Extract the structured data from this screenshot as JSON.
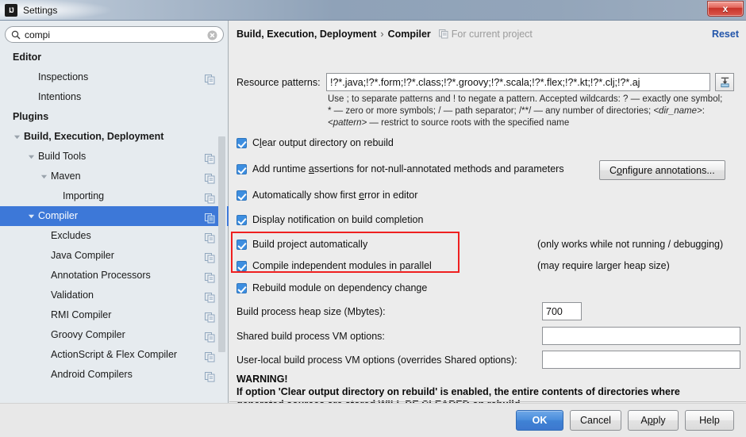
{
  "window": {
    "title": "Settings",
    "app_icon": "intellij-idea-icon",
    "close_label": "x"
  },
  "search": {
    "value": "compi",
    "placeholder": "",
    "icon": "search-icon",
    "clear_icon": "clear-icon"
  },
  "sidebar": {
    "items": [
      {
        "label": "Editor",
        "indent": 16,
        "bold": true,
        "twisty": "",
        "copy": false,
        "selected": false
      },
      {
        "label": "Inspections",
        "indent": 48,
        "bold": false,
        "twisty": "",
        "copy": true,
        "selected": false
      },
      {
        "label": "Intentions",
        "indent": 48,
        "bold": false,
        "twisty": "",
        "copy": false,
        "selected": false
      },
      {
        "label": "Plugins",
        "indent": 16,
        "bold": true,
        "twisty": "",
        "copy": false,
        "selected": false
      },
      {
        "label": "Build, Execution, Deployment",
        "indent": 30,
        "bold": true,
        "twisty": "down",
        "copy": false,
        "selected": false
      },
      {
        "label": "Build Tools",
        "indent": 48,
        "bold": false,
        "twisty": "down",
        "copy": true,
        "selected": false
      },
      {
        "label": "Maven",
        "indent": 64,
        "bold": false,
        "twisty": "down",
        "copy": true,
        "selected": false
      },
      {
        "label": "Importing",
        "indent": 79,
        "bold": false,
        "twisty": "",
        "copy": true,
        "selected": false
      },
      {
        "label": "Compiler",
        "indent": 48,
        "bold": false,
        "twisty": "down",
        "copy": true,
        "selected": true
      },
      {
        "label": "Excludes",
        "indent": 64,
        "bold": false,
        "twisty": "",
        "copy": true,
        "selected": false
      },
      {
        "label": "Java Compiler",
        "indent": 64,
        "bold": false,
        "twisty": "",
        "copy": true,
        "selected": false
      },
      {
        "label": "Annotation Processors",
        "indent": 64,
        "bold": false,
        "twisty": "",
        "copy": true,
        "selected": false
      },
      {
        "label": "Validation",
        "indent": 64,
        "bold": false,
        "twisty": "",
        "copy": true,
        "selected": false
      },
      {
        "label": "RMI Compiler",
        "indent": 64,
        "bold": false,
        "twisty": "",
        "copy": true,
        "selected": false
      },
      {
        "label": "Groovy Compiler",
        "indent": 64,
        "bold": false,
        "twisty": "",
        "copy": true,
        "selected": false
      },
      {
        "label": "ActionScript & Flex Compiler",
        "indent": 64,
        "bold": false,
        "twisty": "",
        "copy": true,
        "selected": false
      },
      {
        "label": "Android Compilers",
        "indent": 64,
        "bold": false,
        "twisty": "",
        "copy": true,
        "selected": false
      }
    ]
  },
  "header": {
    "breadcrumb_root": "Build, Execution, Deployment",
    "breadcrumb_sep": "›",
    "breadcrumb_leaf": "Compiler",
    "scope_label": "For current project",
    "scope_icon": "copy-icon",
    "reset_label": "Reset"
  },
  "compiler": {
    "resource_patterns_label": "Resource patterns:",
    "resource_patterns_value": "!?*.java;!?*.form;!?*.class;!?*.groovy;!?*.scala;!?*.flex;!?*.kt;!?*.clj;!?*.aj",
    "expand_button_icon": "expand-field-icon",
    "hint_line_1": "Use ; to separate patterns and ! to negate a pattern. Accepted wildcards: ? — exactly one symbol;",
    "hint_line_2_a": "* — zero or more symbols; / — path separator; /**/ — any number of directories; ",
    "hint_line_2_b": "<dir_name>",
    "hint_line_2_c": ":",
    "hint_line_3_a": "<pattern>",
    "hint_line_3_b": " — restrict to source roots with the specified name",
    "checkboxes": [
      {
        "label_pre": "C",
        "label_mnemonic": "l",
        "label_post": "ear output directory on rebuild",
        "checked": true
      },
      {
        "label_pre": "Add runtime ",
        "label_mnemonic": "a",
        "label_post": "ssertions for not-null-annotated methods and parameters",
        "checked": true
      },
      {
        "label_pre": "Automatically show first ",
        "label_mnemonic": "e",
        "label_post": "rror in editor",
        "checked": true
      },
      {
        "label_pre": "Display notification on build completion",
        "label_mnemonic": "",
        "label_post": "",
        "checked": true
      },
      {
        "label_pre": "Build project automatically",
        "label_mnemonic": "",
        "label_post": "",
        "checked": true
      },
      {
        "label_pre": "Compile independent modules in parallel",
        "label_mnemonic": "",
        "label_post": "",
        "checked": true
      },
      {
        "label_pre": "Rebuild module on dependency change",
        "label_mnemonic": "",
        "label_post": "",
        "checked": true
      }
    ],
    "configure_annotations_pre": "C",
    "configure_annotations_mnemonic": "o",
    "configure_annotations_post": "nfigure annotations...",
    "note_build_project": "(only works while not running / debugging)",
    "note_parallel": "(may require larger heap size)",
    "heap_label": "Build process heap size (Mbytes):",
    "heap_value": "700",
    "shared_vm_label": "Shared build process VM options:",
    "shared_vm_value": "",
    "userlocal_vm_label": "User-local build process VM options (overrides Shared options):",
    "userlocal_vm_value": "",
    "warning_title": "WARNING!",
    "warning_line_1": "If option 'Clear output directory on rebuild' is enabled, the entire contents of directories where",
    "warning_line_2": "generated sources are stored WILL BE CLEARED on rebuild.",
    "highlight_color": "#ef2020"
  },
  "footer": {
    "ok_label": "OK",
    "cancel_label": "Cancel",
    "apply_pre": "A",
    "apply_mnemonic": "p",
    "apply_post": "ply",
    "help_label": "Help"
  },
  "colors": {
    "accent": "#3d78d8",
    "link": "#2255aa",
    "highlight": "#ef2020",
    "checkbox": "#3d8ee0"
  }
}
